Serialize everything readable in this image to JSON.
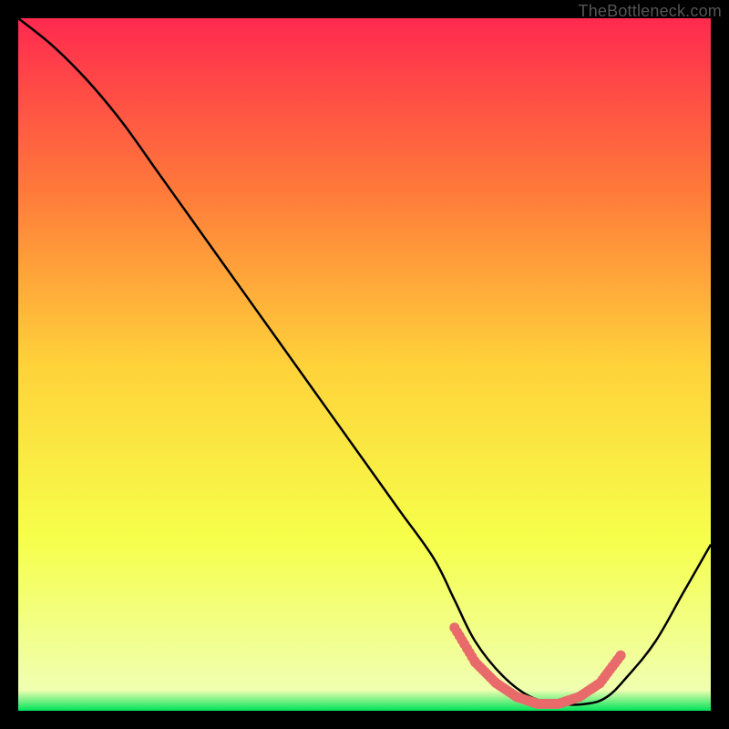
{
  "watermark": "TheBottleneck.com",
  "chart_data": {
    "type": "line",
    "title": "",
    "xlabel": "",
    "ylabel": "",
    "xlim": [
      0,
      100
    ],
    "ylim": [
      0,
      100
    ],
    "grid": false,
    "legend": false,
    "background_gradient": {
      "stops": [
        {
          "offset": 0.0,
          "color": "#ff2a4f"
        },
        {
          "offset": 0.25,
          "color": "#ff7a3a"
        },
        {
          "offset": 0.5,
          "color": "#ffd23a"
        },
        {
          "offset": 0.75,
          "color": "#f6ff4a"
        },
        {
          "offset": 0.97,
          "color": "#f0ffb0"
        },
        {
          "offset": 1.0,
          "color": "#00e25a"
        }
      ]
    },
    "series": [
      {
        "name": "bottleneck-curve",
        "color": "#000000",
        "x": [
          0,
          5,
          10,
          15,
          20,
          25,
          30,
          35,
          40,
          45,
          50,
          55,
          60,
          63,
          66,
          70,
          74,
          78,
          82,
          85,
          88,
          92,
          96,
          100
        ],
        "y": [
          100,
          96,
          91,
          85,
          78,
          71,
          64,
          57,
          50,
          43,
          36,
          29,
          22,
          16,
          10,
          5,
          2,
          1,
          1,
          2,
          5,
          10,
          17,
          24
        ]
      },
      {
        "name": "optimal-band-dots",
        "color": "#e86a6a",
        "style": "dotted-thick",
        "x": [
          63,
          66,
          69,
          72,
          75,
          78,
          81,
          84,
          87
        ],
        "y": [
          12,
          7,
          4,
          2,
          1,
          1,
          2,
          4,
          8
        ]
      }
    ]
  }
}
